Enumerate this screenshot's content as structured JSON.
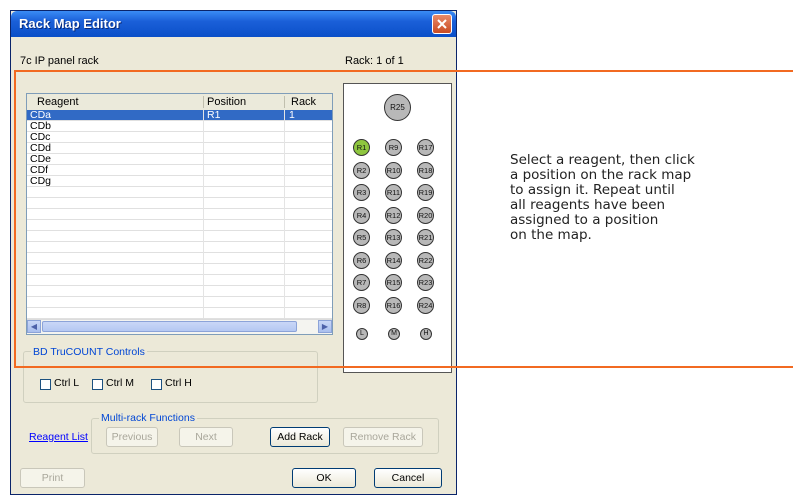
{
  "window": {
    "title": "Rack Map Editor",
    "rack_name": "7c IP panel rack",
    "rack_counter": "Rack:  1 of 1"
  },
  "table": {
    "columns": [
      "Reagent",
      "Position",
      "Rack"
    ],
    "rows": [
      {
        "reagent": "CDa",
        "position": "R1",
        "rack": "1",
        "selected": true
      },
      {
        "reagent": "CDb",
        "position": "",
        "rack": ""
      },
      {
        "reagent": "CDc",
        "position": "",
        "rack": ""
      },
      {
        "reagent": "CDd",
        "position": "",
        "rack": ""
      },
      {
        "reagent": "CDe",
        "position": "",
        "rack": ""
      },
      {
        "reagent": "CDf",
        "position": "",
        "rack": ""
      },
      {
        "reagent": "CDg",
        "position": "",
        "rack": ""
      }
    ]
  },
  "rack_map": {
    "top": "R25",
    "columns": [
      [
        "R1",
        "R2",
        "R3",
        "R4",
        "R5",
        "R6",
        "R7",
        "R8"
      ],
      [
        "R9",
        "R10",
        "R11",
        "R12",
        "R13",
        "R14",
        "R15",
        "R16"
      ],
      [
        "R17",
        "R18",
        "R19",
        "R20",
        "R21",
        "R22",
        "R23",
        "R24"
      ]
    ],
    "bottom": [
      "L",
      "M",
      "H"
    ],
    "assigned": [
      "R1"
    ],
    "assigned_color": "#8ec63f"
  },
  "trucount": {
    "group_label": "BD TruCOUNT Controls",
    "ctrl_l": "Ctrl L",
    "ctrl_m": "Ctrl M",
    "ctrl_h": "Ctrl H"
  },
  "multirack": {
    "group_label": "Multi-rack Functions",
    "reagent_list": "Reagent List",
    "previous": "Previous",
    "next": "Next",
    "add_rack": "Add Rack",
    "remove_rack": "Remove Rack"
  },
  "footer": {
    "print": "Print",
    "ok": "OK",
    "cancel": "Cancel"
  },
  "callout": {
    "text": "Select a reagent, then click\na position on the rack map\nto assign it. Repeat until\nall reagents have been\nassigned to a position\non the map."
  },
  "colors": {
    "highlight": "#f26a21",
    "selection": "#316ac5"
  }
}
